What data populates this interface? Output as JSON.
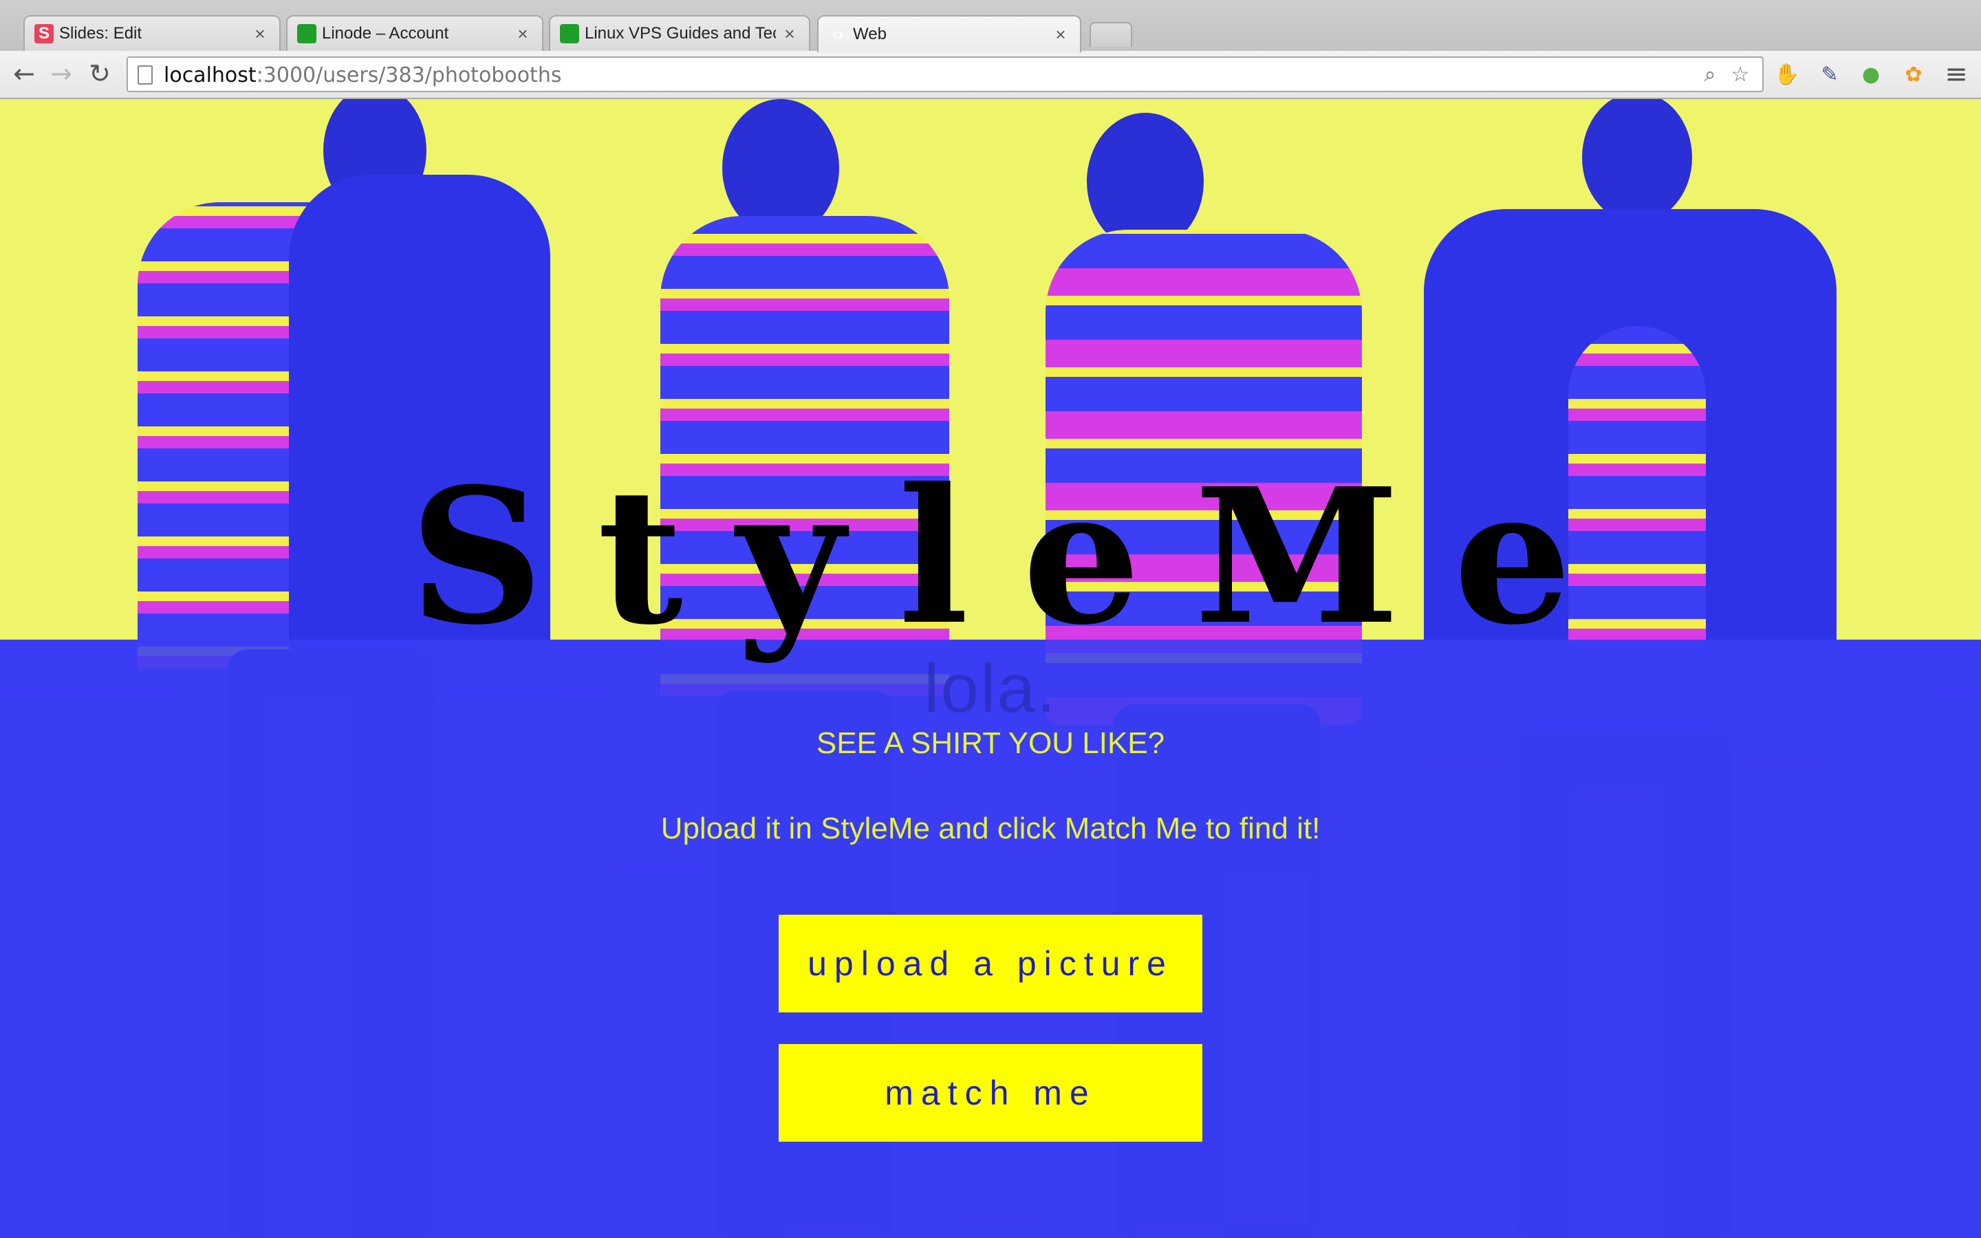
{
  "browser": {
    "tabs": [
      {
        "title": "Slides: Edit",
        "favicon": "S",
        "favicon_name": "slides-favicon-icon"
      },
      {
        "title": "Linode – Account",
        "favicon": "",
        "favicon_name": "linode-favicon-icon"
      },
      {
        "title": "Linux VPS Guides and Tech",
        "favicon": "",
        "favicon_name": "linode-favicon-icon"
      },
      {
        "title": "Web",
        "favicon": "‹›",
        "favicon_name": "code-favicon-icon",
        "active": true
      }
    ],
    "tab_close_glyph": "×",
    "url_host": "localhost",
    "url_path": ":3000/users/383/photobooths",
    "nav": {
      "back": "←",
      "forward": "→",
      "reload": "↻"
    },
    "omnibox_icons": {
      "zoom": "⌕",
      "star": "☆"
    },
    "extensions": [
      {
        "name": "adblock-icon",
        "glyph": "✋",
        "color": "#e3362f"
      },
      {
        "name": "eyedropper-icon",
        "glyph": "✎",
        "color": "#4a5a8a"
      },
      {
        "name": "evernote-icon",
        "glyph": "●",
        "color": "#56b046"
      },
      {
        "name": "honey-icon",
        "glyph": "✿",
        "color": "#f29b1a"
      }
    ],
    "menu_glyph": "≡"
  },
  "page": {
    "title": "StyleMe",
    "logo": "lola.",
    "tagline": "SEE A SHIRT YOU LIKE?",
    "instruction": "Upload it in StyleMe and click Match Me to find it!",
    "upload_button": "upload a picture",
    "match_button": "match me"
  },
  "colors": {
    "hero_yellow": "#eef56a",
    "overlay_blue": "#3a3ef2",
    "button_yellow": "#ffff00",
    "button_text": "#1f1fb8",
    "text_yellow": "#e7f23c"
  }
}
